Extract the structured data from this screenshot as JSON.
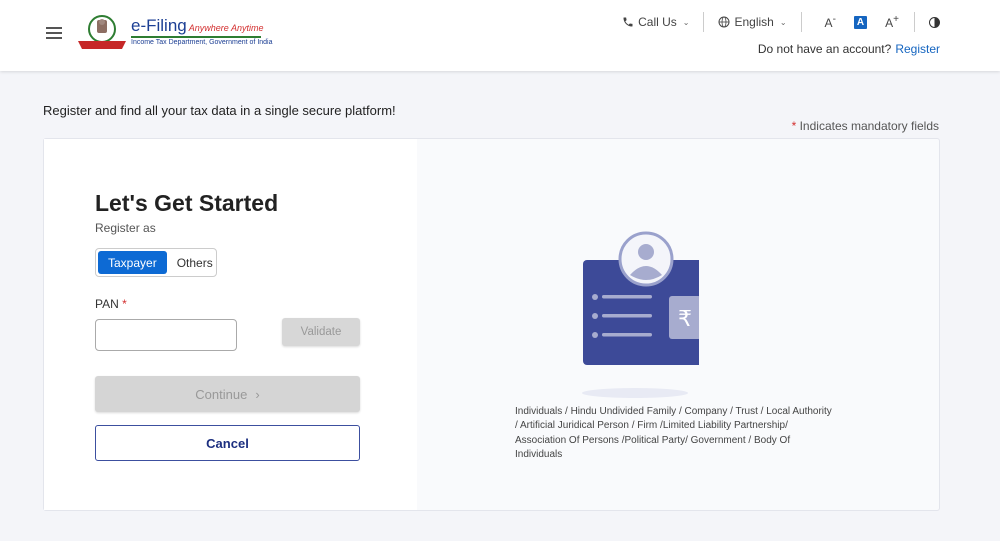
{
  "header": {
    "logo": {
      "title": "e-Filing",
      "tagline": "Anywhere Anytime",
      "subtitle": "Income Tax Department, Government of India"
    },
    "call_us": "Call Us",
    "language": "English",
    "font_controls": {
      "decrease": "A",
      "default": "A",
      "increase": "A"
    },
    "account_prompt": "Do not have an account?",
    "register_link": "Register"
  },
  "page": {
    "tagline": "Register and find all your tax data in a single secure platform!",
    "mandatory_note": "Indicates mandatory fields",
    "required_mark": "*"
  },
  "form": {
    "heading": "Let's Get Started",
    "register_as_label": "Register as",
    "register_options": [
      {
        "label": "Taxpayer",
        "selected": true
      },
      {
        "label": "Others",
        "selected": false
      }
    ],
    "pan_label": "PAN",
    "pan_value": "",
    "pan_placeholder": "",
    "validate_label": "Validate",
    "continue_label": "Continue",
    "continue_arrow": "›",
    "cancel_label": "Cancel"
  },
  "info": {
    "rupee_symbol": "₹",
    "description": "Individuals / Hindu Undivided Family / Company / Trust / Local Authority / Artificial Juridical Person / Firm /Limited Liability Partnership/ Association Of Persons /Political Party/ Government / Body Of Individuals"
  },
  "colors": {
    "primary": "#0d6ad4",
    "navy": "#3d4a98",
    "required": "#d32f2f",
    "link": "#1565c0"
  }
}
